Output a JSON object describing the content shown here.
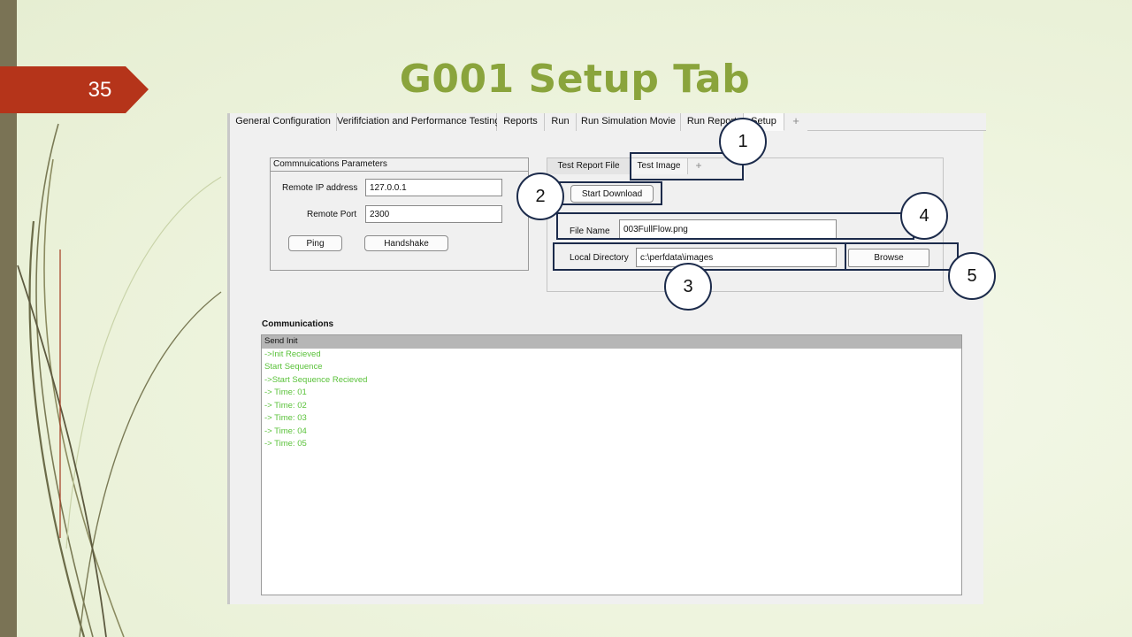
{
  "slide": {
    "number": "35",
    "title": "G001 Setup Tab"
  },
  "app": {
    "tabs": [
      {
        "label": "General Configuration"
      },
      {
        "label": "Verififciation and Performance Testing"
      },
      {
        "label": "Reports"
      },
      {
        "label": "Run"
      },
      {
        "label": "Run Simulation Movie"
      },
      {
        "label": "Run Report"
      },
      {
        "label": "Setup"
      }
    ],
    "add_tab_symbol": "+",
    "active_tab": "Setup",
    "comm_params": {
      "title": "Commnuications Parameters",
      "ip_label": "Remote IP address",
      "ip_value": "127.0.0.1",
      "port_label": "Remote Port",
      "port_value": "2300",
      "ping_label": "Ping",
      "handshake_label": "Handshake"
    },
    "subtabs": [
      {
        "label": "Test Report File"
      },
      {
        "label": "Test Image"
      }
    ],
    "active_subtab": "Test Image",
    "test_image": {
      "start_download_label": "Start Download",
      "file_name_label": "File Name",
      "file_name_value": "003FullFlow.png",
      "local_dir_label": "Local Directory",
      "local_dir_value": "c:\\perfdata\\images",
      "browse_label": "Browse"
    },
    "communications": {
      "title": "Communications",
      "lines": [
        "Send Init",
        "->Init Recieved",
        "Start Sequence",
        "->Start Sequence Recieved",
        "-> Time: 01",
        "-> Time: 02",
        "-> Time: 03",
        "-> Time: 04",
        "-> Time: 05"
      ],
      "selected_index": 0
    }
  },
  "callouts": [
    "1",
    "2",
    "3",
    "4",
    "5"
  ],
  "colors": {
    "slide_number_bg": "#b5341a",
    "title": "#8aa43c",
    "left_bar": "#7a7355",
    "callout_border": "#1c2b4b",
    "comm_text": "#5ac23a",
    "selected_row": "#b6b6b6"
  }
}
